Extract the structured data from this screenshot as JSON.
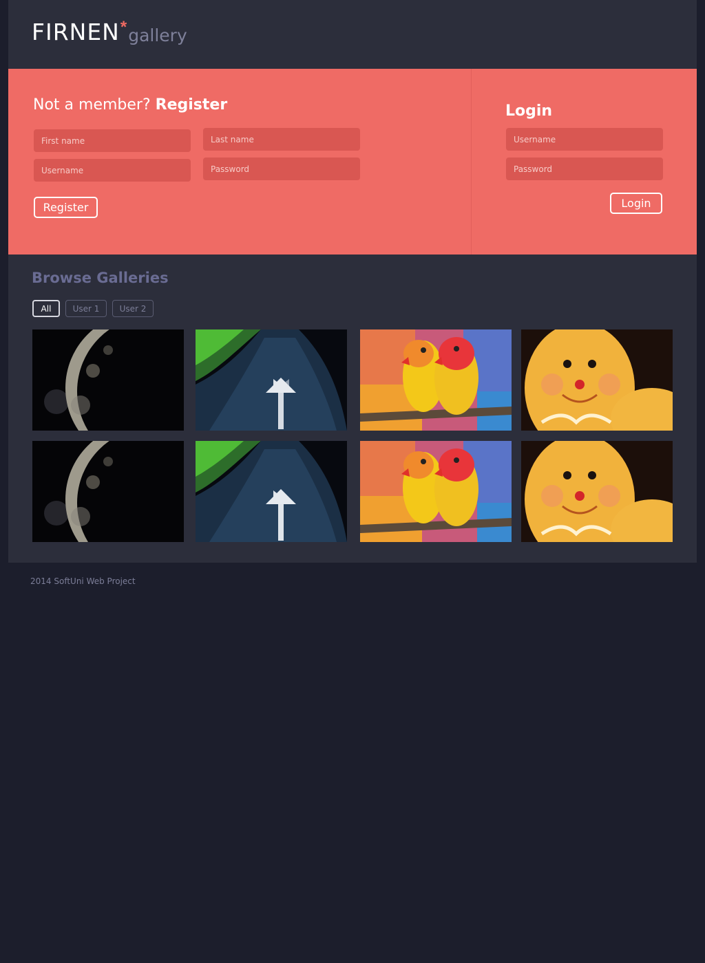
{
  "brand": {
    "name": "FIRNEN",
    "star": "*",
    "sub": "gallery"
  },
  "register": {
    "heading_prefix": "Not a member?",
    "heading_bold": "Register",
    "first_name_placeholder": "First name",
    "last_name_placeholder": "Last name",
    "username_placeholder": "Username",
    "password_placeholder": "Password",
    "button_label": "Register"
  },
  "login": {
    "heading": "Login",
    "username_placeholder": "Username",
    "password_placeholder": "Password",
    "button_label": "Login"
  },
  "browse": {
    "title": "Browse Galleries",
    "filters": [
      "All",
      "User 1",
      "User 2"
    ],
    "active_filter": "All"
  },
  "gallery": {
    "thumbnails": [
      "moon",
      "road-arrow",
      "parrots",
      "gingerbread",
      "moon",
      "road-arrow",
      "parrots",
      "gingerbread"
    ]
  },
  "footer": {
    "text": "2014 SoftUni Web Project"
  },
  "colors": {
    "accent": "#ef6b65",
    "header_bg": "#2c2e3b",
    "page_bg": "#1c1e2c"
  }
}
